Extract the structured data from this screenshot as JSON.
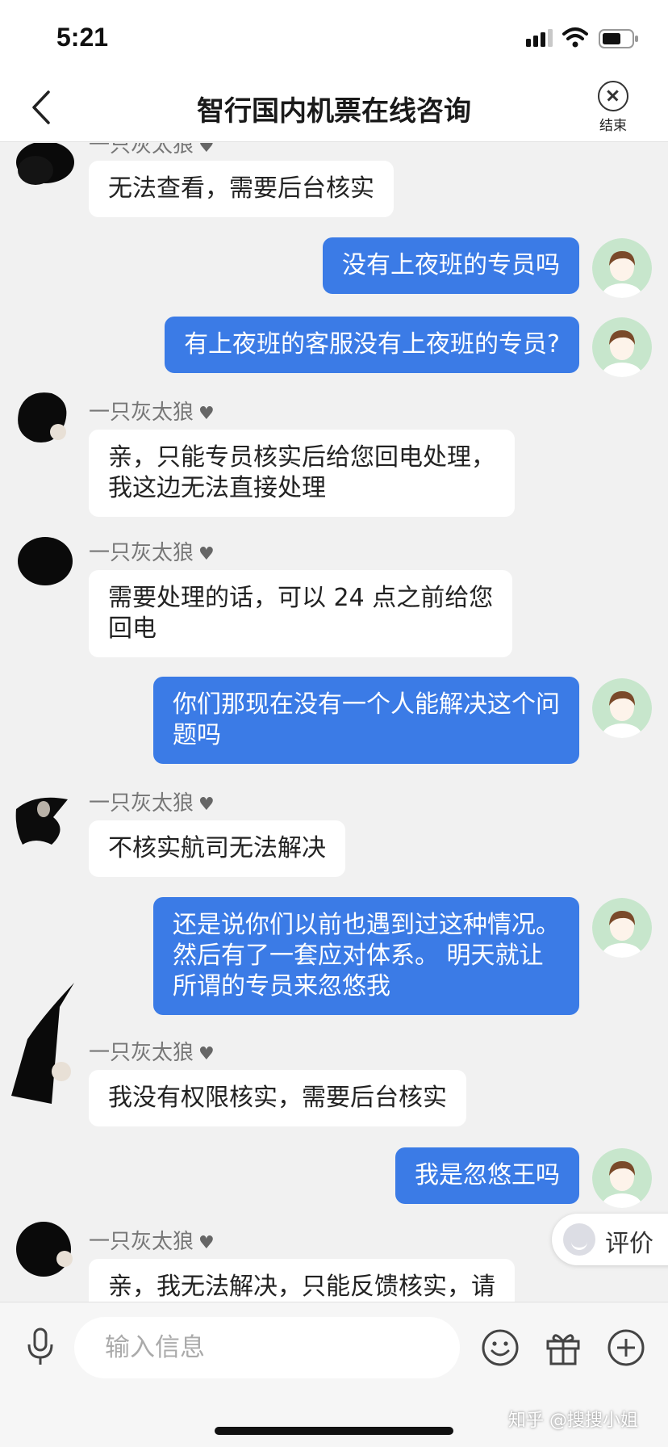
{
  "status_bar": {
    "time": "5:21"
  },
  "header": {
    "title": "智行国内机票在线咨询",
    "end_label": "结束"
  },
  "agent_name": "一只灰太狼",
  "messages": [
    {
      "from": "agent",
      "name": "一只灰太狼",
      "text": "无法查看，需要后台核实"
    },
    {
      "from": "user",
      "text": "没有上夜班的专员吗"
    },
    {
      "from": "user",
      "text": "有上夜班的客服没有上夜班的专员?"
    },
    {
      "from": "agent",
      "name": "一只灰太狼",
      "lines": [
        "亲，只能专员核实后给您回电处理，",
        "我这边无法直接处理"
      ]
    },
    {
      "from": "agent",
      "name": "一只灰太狼",
      "lines": [
        "需要处理的话，可以 24 点之前给您",
        "回电"
      ]
    },
    {
      "from": "user",
      "lines": [
        "你们那现在没有一个人能解决这个问",
        "题吗"
      ]
    },
    {
      "from": "agent",
      "name": "一只灰太狼",
      "text": "不核实航司无法解决"
    },
    {
      "from": "user",
      "lines": [
        "还是说你们以前也遇到过这种情况。",
        "然后有了一套应对体系。 明天就让",
        "所谓的专员来忽悠我"
      ]
    },
    {
      "from": "agent",
      "name": "一只灰太狼",
      "text": "我没有权限核实，需要后台核实"
    },
    {
      "from": "user",
      "text": "我是忽悠王吗"
    },
    {
      "from": "agent",
      "name": "一只灰太狼",
      "text": "亲，我无法解决，只能反馈核实，请"
    }
  ],
  "rate_button": {
    "label": "评价"
  },
  "input": {
    "placeholder": "输入信息",
    "value": ""
  },
  "watermark": "知乎 @搜搜小姐",
  "colors": {
    "user_bubble": "#3b7be6",
    "agent_bubble": "#ffffff",
    "background": "#f1f1f1"
  }
}
